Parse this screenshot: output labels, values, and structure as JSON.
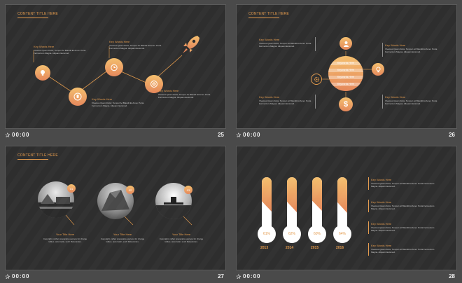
{
  "slides": [
    {
      "number": "25",
      "time": "00:00",
      "title": "CONTENT  TITLE HERE",
      "items": [
        {
          "kw": "Key Words Here",
          "text": "Vivamus Quam Dolor, Tempor Ac Blandit Et Amet. Porta Fermentum Magna. Aliquam Euismod."
        },
        {
          "kw": "Key Words Here",
          "text": "Vivamus Quam Dolor, Tempor Ac Blandit Et Amet. Porta Fermentum Magna. Aliquam Euismod."
        },
        {
          "kw": "Key Words Here",
          "text": "Vivamus Quam Dolor, Tempor Ac Blandit Et Amet. Porta Fermentum Magna. Aliquam Euismod."
        },
        {
          "kw": "Key Words Here",
          "text": "Vivamus Quam Dolor, Tempor Ac Blandit Et Amet. Porta Fermentum Magna. Aliquam Euismod."
        }
      ]
    },
    {
      "number": "26",
      "time": "00:00",
      "title": "CONTENT  TITLE HERE",
      "stripes": [
        "Keywords Here",
        "Keywords Here",
        "Keywords Here",
        "Keywords Here"
      ],
      "items": [
        {
          "kw": "Key Words Here",
          "text": "Vivamus Quam Dolor, Tempor Ac Blandit Et Amet. Porta Fermentum Magna. Aliquam Euismod."
        },
        {
          "kw": "Key Words Here",
          "text": "Vivamus Quam Dolor, Tempor Ac Blandit Et Amet. Porta Fermentum Magna. Aliquam Euismod."
        },
        {
          "kw": "Key Words Here",
          "text": "Vivamus Quam Dolor, Tempor Ac Blandit Et Amet. Porta Fermentum Magna. Aliquam Euismod."
        },
        {
          "kw": "Key Words Here",
          "text": "Vivamus Quam Dolor, Tempor Ac Blandit Et Amet. Porta Fermentum Magna. Aliquam Euismod."
        }
      ]
    },
    {
      "number": "27",
      "time": "00:00",
      "title": "CONTENT  TITLE HERE",
      "items": [
        {
          "badge": "01",
          "title": "Your Title Here",
          "text": "Copyright, rather preparatio uso/uos for charge tables. automatic, such Relevantes."
        },
        {
          "badge": "02",
          "title": "Your Title Here",
          "text": "Copyright, rather preparatio uso/uos for charge tables. automatic, such Relevantes."
        },
        {
          "badge": "03",
          "title": "Your Title Here",
          "text": "Copyright, rather preparatio uso/uos for charge tables. automatic, such Relevantes."
        }
      ]
    },
    {
      "number": "28",
      "time": "00:00",
      "bars": [
        {
          "year": "2013",
          "pct": "61%",
          "value": 0.61
        },
        {
          "year": "2014",
          "pct": "62%",
          "value": 0.62
        },
        {
          "year": "2015",
          "pct": "60%",
          "value": 0.6
        },
        {
          "year": "2016",
          "pct": "64%",
          "value": 0.64
        }
      ],
      "items": [
        {
          "kw": "Key Words Here",
          "text": "Vivamus Quam Dolor, Tempor Ac Blandit Et Amet. Porta Fermentum Magna. Aliquam Euismod."
        },
        {
          "kw": "Key Words Here",
          "text": "Vivamus Quam Dolor, Tempor Ac Blandit Et Amet. Porta Fermentum Magna. Aliquam Euismod."
        },
        {
          "kw": "Key Words Here",
          "text": "Vivamus Quam Dolor, Tempor Ac Blandit Et Amet. Porta Fermentum Magna. Aliquam Euismod."
        },
        {
          "kw": "Key Words Here",
          "text": "Vivamus Quam Dolor, Tempor Ac Blandit Et Amet. Porta Fermentum Magna. Aliquam Euismod."
        }
      ]
    }
  ],
  "colors": {
    "accent": "#e39a4c",
    "gradient_top": "#f4bf6e",
    "gradient_bottom": "#e5875a",
    "slide_bg": "#2e2e2e",
    "page_bg": "#4a4a4a"
  },
  "icons": [
    "rocket-icon",
    "lightbulb-icon",
    "hand-icon",
    "alarm-clock-icon",
    "target-icon",
    "user-icon",
    "gear-icon",
    "dollar-icon",
    "star-icon"
  ]
}
